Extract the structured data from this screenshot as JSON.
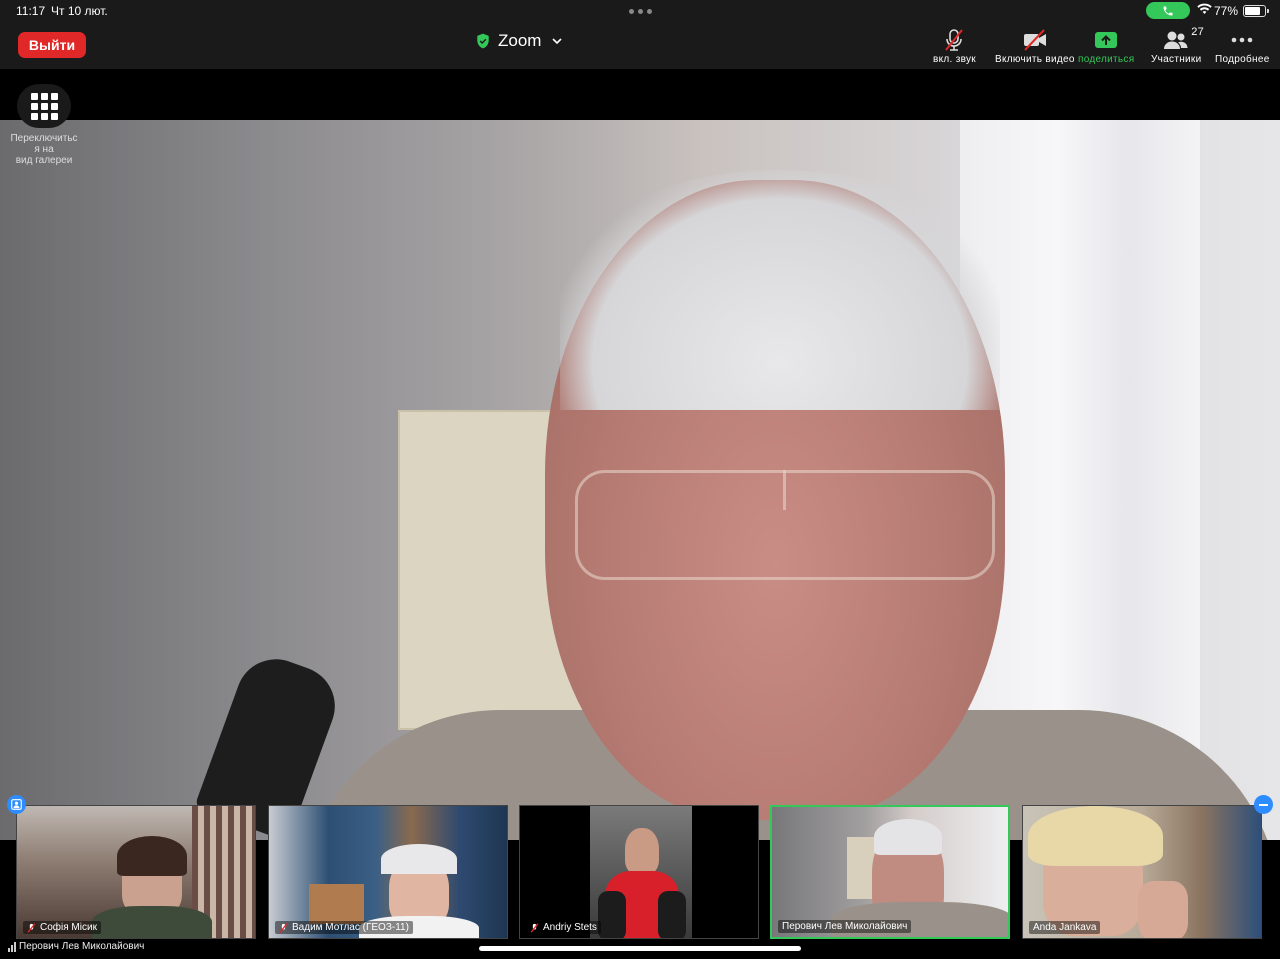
{
  "status_bar": {
    "time": "11:17",
    "date": "Чт 10 лют.",
    "battery": "77%",
    "battery_level": 0.77
  },
  "toolbar": {
    "leave_label": "Выйти",
    "title": "Zoom",
    "audio_label": "вкл. звук",
    "video_label": "Включить видео",
    "share_label": "поделиться",
    "participants_label": "Участники",
    "participants_count": "27",
    "more_label": "Подробнее"
  },
  "gallery_toggle": {
    "label": "Переключитьс я на вид галереи",
    "line1": "Переключитьс",
    "line2": "я на",
    "line3": "вид галереи"
  },
  "active_speaker": {
    "name": "Перович Лев Миколайович"
  },
  "thumbnails": [
    {
      "name": "Софія Місик",
      "muted": true
    },
    {
      "name": "Вадим Мотлас (ГЕОЗ-11)",
      "muted": true
    },
    {
      "name": "Andriy Stets",
      "muted": true
    },
    {
      "name": "Перович Лев Миколайович",
      "muted": false,
      "active": true
    },
    {
      "name": "Anda Jankava",
      "muted": false
    }
  ],
  "colors": {
    "leave": "#e02828",
    "share": "#34c759",
    "active_border": "#34c759",
    "accent": "#2d8cff"
  }
}
